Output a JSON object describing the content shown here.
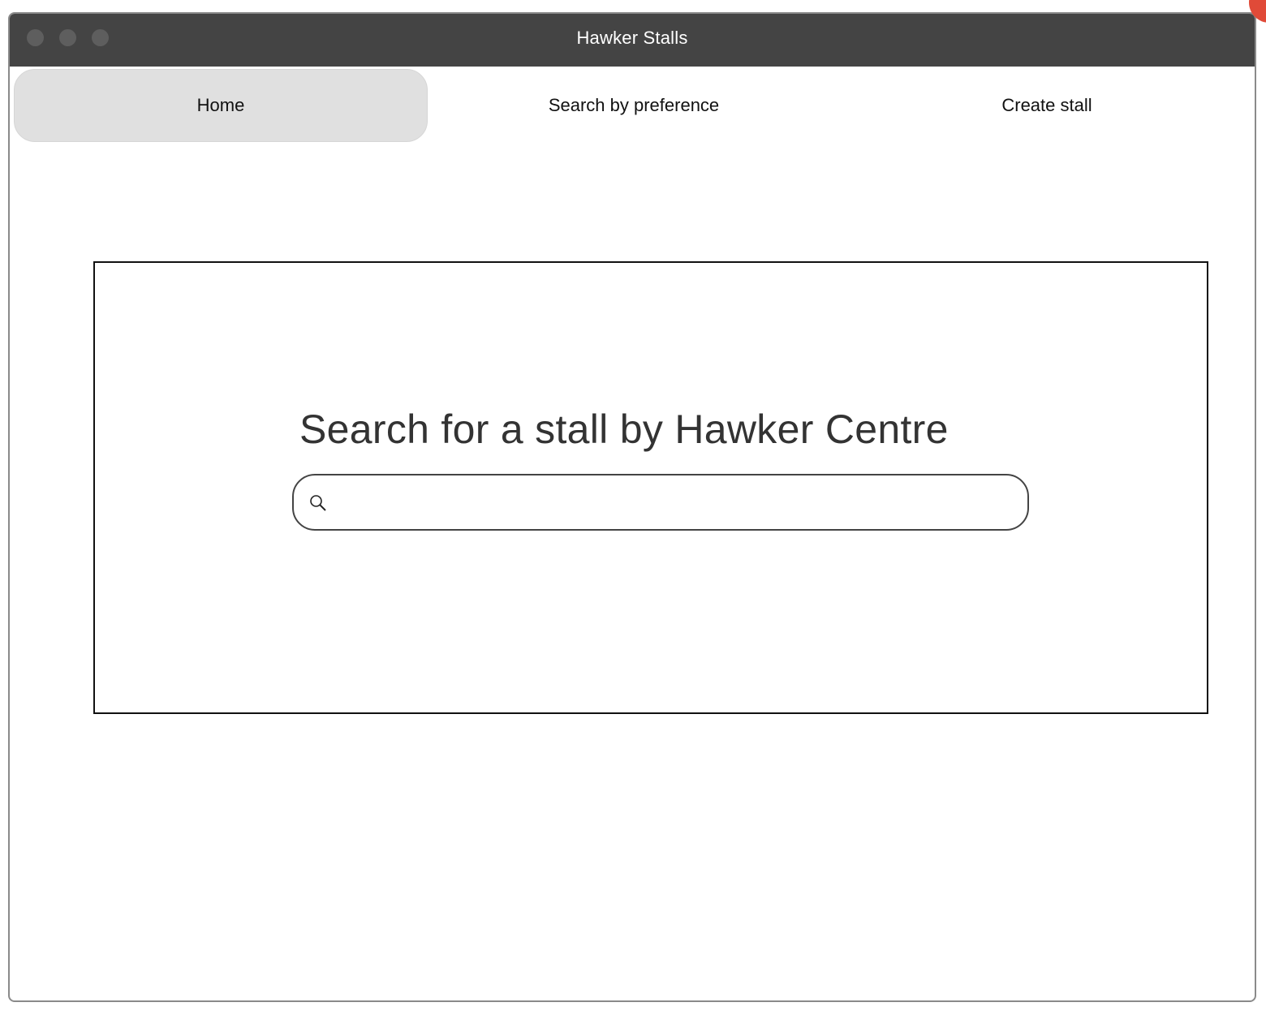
{
  "window": {
    "title": "Hawker Stalls"
  },
  "nav": {
    "items": [
      {
        "label": "Home",
        "active": true
      },
      {
        "label": "Search by preference",
        "active": false
      },
      {
        "label": "Create stall",
        "active": false
      }
    ]
  },
  "main": {
    "heading": "Search for a stall by Hawker Centre",
    "search": {
      "value": "",
      "placeholder": "",
      "icon": "search-icon"
    }
  },
  "colors": {
    "titlebar": "#444444",
    "active_tab": "#e0e0e0",
    "badge": "#e04a38"
  }
}
